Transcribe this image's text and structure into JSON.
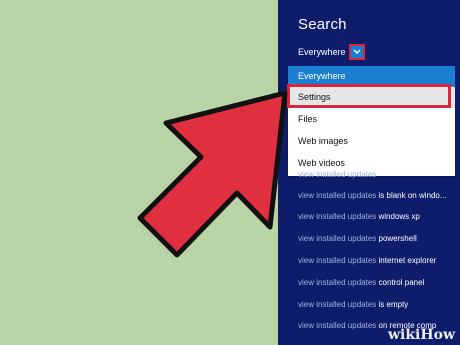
{
  "charm": {
    "title": "Search",
    "scope_label": "Everywhere",
    "dropdown_icon": "chevron-down-icon",
    "options": [
      "Everywhere",
      "Settings",
      "Files",
      "Web images",
      "Web videos"
    ],
    "selected_option": "Everywhere",
    "highlighted_option": "Settings"
  },
  "suggestions": [
    {
      "prefix": "view installed updates",
      "suffix": ""
    },
    {
      "prefix": "view installed updates",
      "suffix": " is blank on windo..."
    },
    {
      "prefix": "view installed updates",
      "suffix": " windows xp"
    },
    {
      "prefix": "view installed updates",
      "suffix": " powershell"
    },
    {
      "prefix": "view installed updates",
      "suffix": " internet explorer"
    },
    {
      "prefix": "view installed updates",
      "suffix": " control panel"
    },
    {
      "prefix": "view installed updates",
      "suffix": " is empty"
    },
    {
      "prefix": "view installed updates",
      "suffix": " on remote comp"
    }
  ],
  "watermark": "wikiHow",
  "colors": {
    "background_left": "#b9d4a6",
    "charm_bg": "#0e1d6b",
    "accent_blue": "#1a7fd0",
    "arrow_red": "#e0303f",
    "outline_red": "#d7263d"
  }
}
